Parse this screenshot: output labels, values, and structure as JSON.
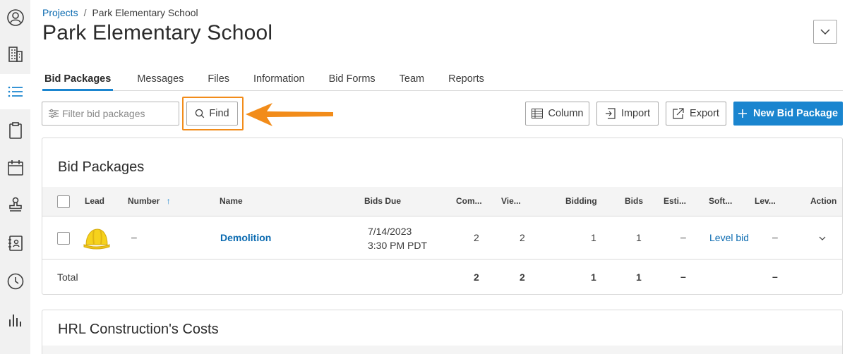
{
  "sidebar": {
    "items": [
      {
        "icon": "user-icon"
      },
      {
        "icon": "building-icon"
      },
      {
        "icon": "list-icon",
        "active": true
      },
      {
        "icon": "clipboard-icon"
      },
      {
        "icon": "calendar-icon"
      },
      {
        "icon": "stamp-icon"
      },
      {
        "icon": "address-book-icon"
      },
      {
        "icon": "clock-icon"
      },
      {
        "icon": "bar-chart-icon"
      }
    ]
  },
  "breadcrumb": {
    "link": "Projects",
    "separator": "/",
    "current": "Park Elementary School"
  },
  "page_title": "Park Elementary School",
  "tabs": [
    {
      "label": "Bid Packages",
      "active": true
    },
    {
      "label": "Messages"
    },
    {
      "label": "Files"
    },
    {
      "label": "Information"
    },
    {
      "label": "Bid Forms"
    },
    {
      "label": "Team"
    },
    {
      "label": "Reports"
    }
  ],
  "toolbar": {
    "filter_placeholder": "Filter bid packages",
    "find_label": "Find",
    "column_label": "Column",
    "import_label": "Import",
    "export_label": "Export",
    "new_label": "New Bid Package"
  },
  "colors": {
    "accent": "#1a85cf",
    "highlight": "#f28c1a",
    "link": "#0a6ab0"
  },
  "bid_packages": {
    "title": "Bid Packages",
    "columns": [
      "Lead",
      "Number",
      "Name",
      "Bids Due",
      "Com...",
      "Vie...",
      "Bidding",
      "Bids",
      "Esti...",
      "Soft...",
      "Lev...",
      "Action"
    ],
    "sort_indicator": "↑",
    "rows": [
      {
        "number": "–",
        "name": "Demolition",
        "bids_due_date": "7/14/2023",
        "bids_due_time": "3:30 PM PDT",
        "committed": "2",
        "viewed": "2",
        "bidding": "1",
        "bids": "1",
        "estimate": "–",
        "software": "Level bid",
        "leveled": "–"
      }
    ],
    "total": {
      "label": "Total",
      "committed": "2",
      "viewed": "2",
      "bidding": "1",
      "bids": "1",
      "estimate": "–",
      "leveled": "–"
    }
  },
  "costs": {
    "title": "HRL Construction's Costs"
  }
}
